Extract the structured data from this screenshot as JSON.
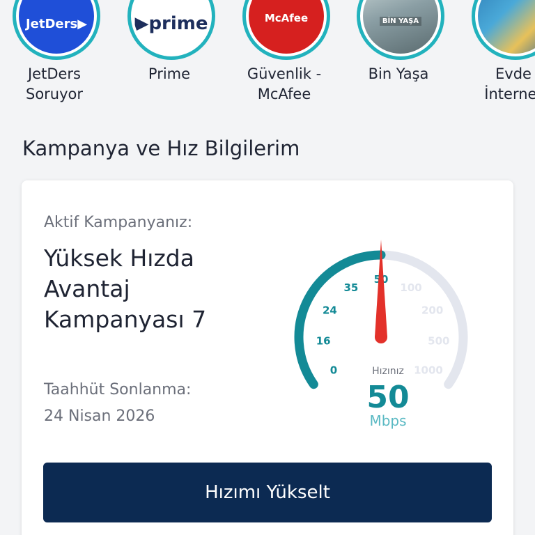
{
  "stories": [
    {
      "label": "JetDers\nSoruyor",
      "logo_text": "JetDers▶"
    },
    {
      "label": "Prime",
      "logo_text": "▶prime"
    },
    {
      "label": "Güvenlik -\nMcAfee",
      "logo_text": "McAfee"
    },
    {
      "label": "Bin Yaşa",
      "logo_text": "BİN YAŞA"
    },
    {
      "label": "Evde\nİnternet",
      "logo_text": ""
    }
  ],
  "section": {
    "title": "Kampanya ve Hız Bilgilerim"
  },
  "card": {
    "active_label": "Aktif Kampanyanız:",
    "campaign_name": "Yüksek Hızda Avantaj Kampanyası 7",
    "commit_label": "Taahhüt Sonlanma:",
    "commit_date": "24 Nisan 2026",
    "button_label": "Hızımı Yükselt"
  },
  "gauge": {
    "speed_label": "Hızınız",
    "speed": "50",
    "unit": "Mbps",
    "ticks": [
      "0",
      "16",
      "24",
      "35",
      "50",
      "100",
      "200",
      "500",
      "1000"
    ],
    "active_ticks": 5,
    "current_value": 50
  },
  "colors": {
    "teal": "#138a96",
    "ring": "#22b2bd",
    "inactive": "#e3e6ee",
    "needle": "#e3312a",
    "button": "#0c2a52",
    "unit": "#5ab9c3"
  }
}
